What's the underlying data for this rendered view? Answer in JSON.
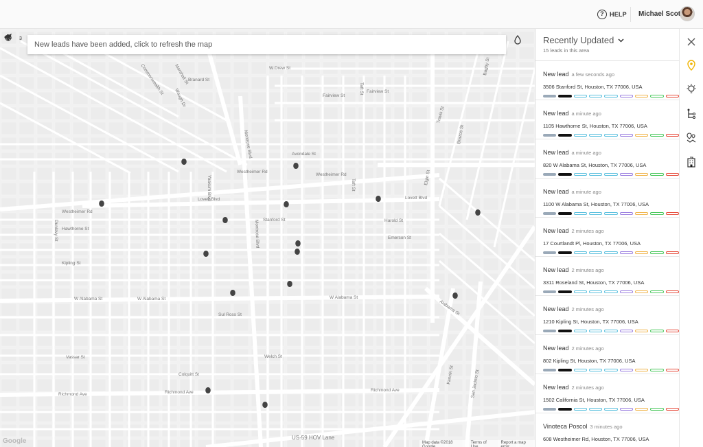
{
  "header": {
    "help_label": "HELP",
    "user_name": "Michael Scott"
  },
  "map": {
    "banner_text": "New leads have been added, click to refresh the map",
    "layers_badge": "3",
    "google_logo": "Google",
    "footer": {
      "map_data": "Map data ©2018 Google",
      "terms": "Terms of Use",
      "report": "Report a map error"
    },
    "road_labels": [
      "W Drew St",
      "Taft St",
      "Fairview St",
      "Fairview St",
      "Westheimer Rd",
      "Westheimer Rd",
      "Westheimer Rd",
      "Lovett Blvd",
      "Lovett Blvd",
      "Hawthorne St",
      "Emerson St",
      "Kipling St",
      "W Alabama St",
      "W Alabama St",
      "W Alabama St",
      "Richmond Ave",
      "Richmond Ave",
      "Richmond Ave",
      "Montrose Blvd",
      "Montrose Blvd",
      "Dunlavy St",
      "Yoakum Blvd",
      "US-59 HOV Lane",
      "Bagby St",
      "Brazos St",
      "Elgin St",
      "Travis St",
      "Alabama St",
      "Fannin St",
      "San Jacinto St",
      "Commonwealth St",
      "Marshall St",
      "Waugh Dr",
      "Branard St",
      "Harold St",
      "Sul Ross St",
      "Colquitt St",
      "Vassar St",
      "Welch St",
      "Avondale St",
      "Stanford St",
      "Taft St"
    ]
  },
  "panel": {
    "title": "Recently Updated",
    "subtitle": "15 leads in this area",
    "leads": [
      {
        "name": "New lead",
        "time": "a few seconds ago",
        "address": "3506 Stanford St, Houston, TX 77006, USA"
      },
      {
        "name": "New lead",
        "time": "a minute ago",
        "address": "1105 Hawthorne St, Houston, TX 77006, USA"
      },
      {
        "name": "New lead",
        "time": "a minute ago",
        "address": "820 W Alabama St, Houston, TX 77006, USA"
      },
      {
        "name": "New lead",
        "time": "a minute ago",
        "address": "1100 W Alabama St, Houston, TX 77006, USA"
      },
      {
        "name": "New lead",
        "time": "2 minutes ago",
        "address": "17 Courtlandt Pl, Houston, TX 77006, USA"
      },
      {
        "name": "New lead",
        "time": "2 minutes ago",
        "address": "3311 Roseland St, Houston, TX 77006, USA"
      },
      {
        "name": "New lead",
        "time": "2 minutes ago",
        "address": "1210 Kipling St, Houston, TX 77006, USA"
      },
      {
        "name": "New lead",
        "time": "2 minutes ago",
        "address": "802 Kipling St, Houston, TX 77006, USA"
      },
      {
        "name": "New lead",
        "time": "2 minutes ago",
        "address": "1502 California St, Houston, TX 77006, USA"
      },
      {
        "name": "Vinoteca Poscol",
        "time": "3 minutes ago",
        "address": "608 Westheimer Rd, Houston, TX 77006, USA"
      }
    ],
    "stage_colors": [
      "#9aa9b8",
      "#111111",
      "#5bc0de",
      "#5bc0de",
      "#5bc0de",
      "#9b7fe0",
      "#f0b44a",
      "#47c75a",
      "#e74c3c"
    ],
    "active_stage_index": 1
  },
  "rail": {
    "icons": [
      "close-icon",
      "map-pin-icon",
      "lightbulb-icon",
      "route-icon",
      "map-route-icon",
      "building-icon"
    ],
    "accent_color": "#f0b400"
  },
  "map_pins_count": 15
}
